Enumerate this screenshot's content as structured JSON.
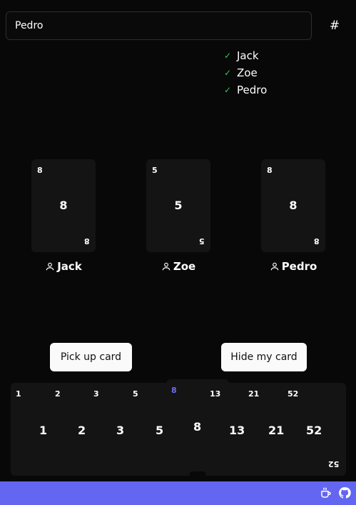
{
  "name_input": {
    "value": "Pedro"
  },
  "hash_icon": "#",
  "players_ready": [
    {
      "check": "✓",
      "name": "Jack"
    },
    {
      "check": "✓",
      "name": "Zoe"
    },
    {
      "check": "✓",
      "name": "Pedro"
    }
  ],
  "table_cards": [
    {
      "value": "8",
      "player": "Jack"
    },
    {
      "value": "5",
      "player": "Zoe"
    },
    {
      "value": "8",
      "player": "Pedro"
    }
  ],
  "buttons": {
    "pick_up": "Pick up card",
    "hide": "Hide my card"
  },
  "hand": {
    "cards": [
      "1",
      "2",
      "3",
      "5",
      "8",
      "13",
      "21",
      "52"
    ],
    "selected": "8",
    "last_corner": "52"
  },
  "footer": {
    "icons": [
      "coffee-icon",
      "github-icon"
    ]
  },
  "colors": {
    "accent": "#6366f1",
    "check": "#34c759",
    "selected": "#6c6ff2"
  }
}
